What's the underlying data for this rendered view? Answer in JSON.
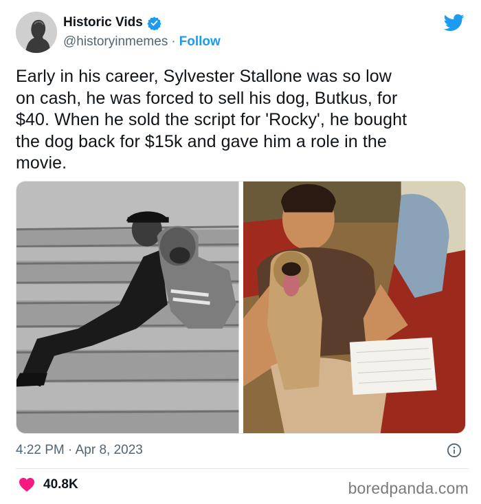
{
  "author": {
    "name": "Historic Vids",
    "handle": "@historyinmemes",
    "separator": "·",
    "follow_label": "Follow",
    "verified_icon": "verified-badge-icon",
    "avatar_icon": "bust-avatar"
  },
  "tweet": {
    "text": "Early in his career, Sylvester Stallone was so low\non cash, he was forced to sell his dog, Butkus, for\n$40. When he sold the script for 'Rocky', he bought\nthe dog back for $15k and gave him a role in the\nmovie.",
    "timestamp": "4:22 PM · Apr 8, 2023"
  },
  "engagement": {
    "likes": "40.8K"
  },
  "watermark": "boredpanda.com",
  "colors": {
    "accent": "#1d9bf0",
    "like": "#f91880",
    "muted": "#536471"
  }
}
